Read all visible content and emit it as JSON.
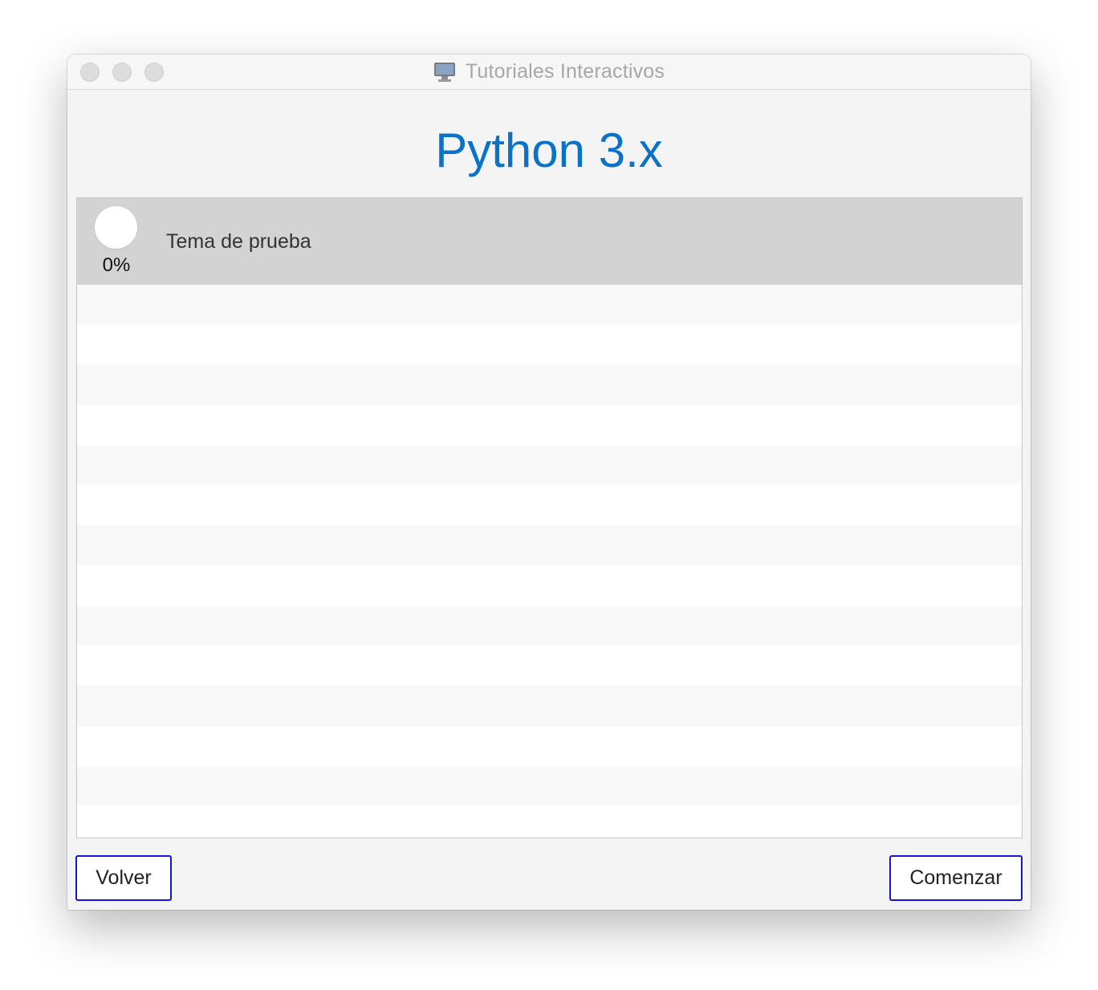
{
  "window": {
    "title": "Tutoriales Interactivos",
    "app_icon": "monitor-icon"
  },
  "main": {
    "heading": "Python 3.x",
    "topics": [
      {
        "label": "Tema de prueba",
        "progress_text": "0%",
        "progress_fraction": 0,
        "selected": true
      }
    ]
  },
  "footer": {
    "back_label": "Volver",
    "start_label": "Comenzar"
  },
  "colors": {
    "heading": "#0a72c8",
    "selected_row": "#d3d3d3",
    "button_border": "#1414d9"
  }
}
